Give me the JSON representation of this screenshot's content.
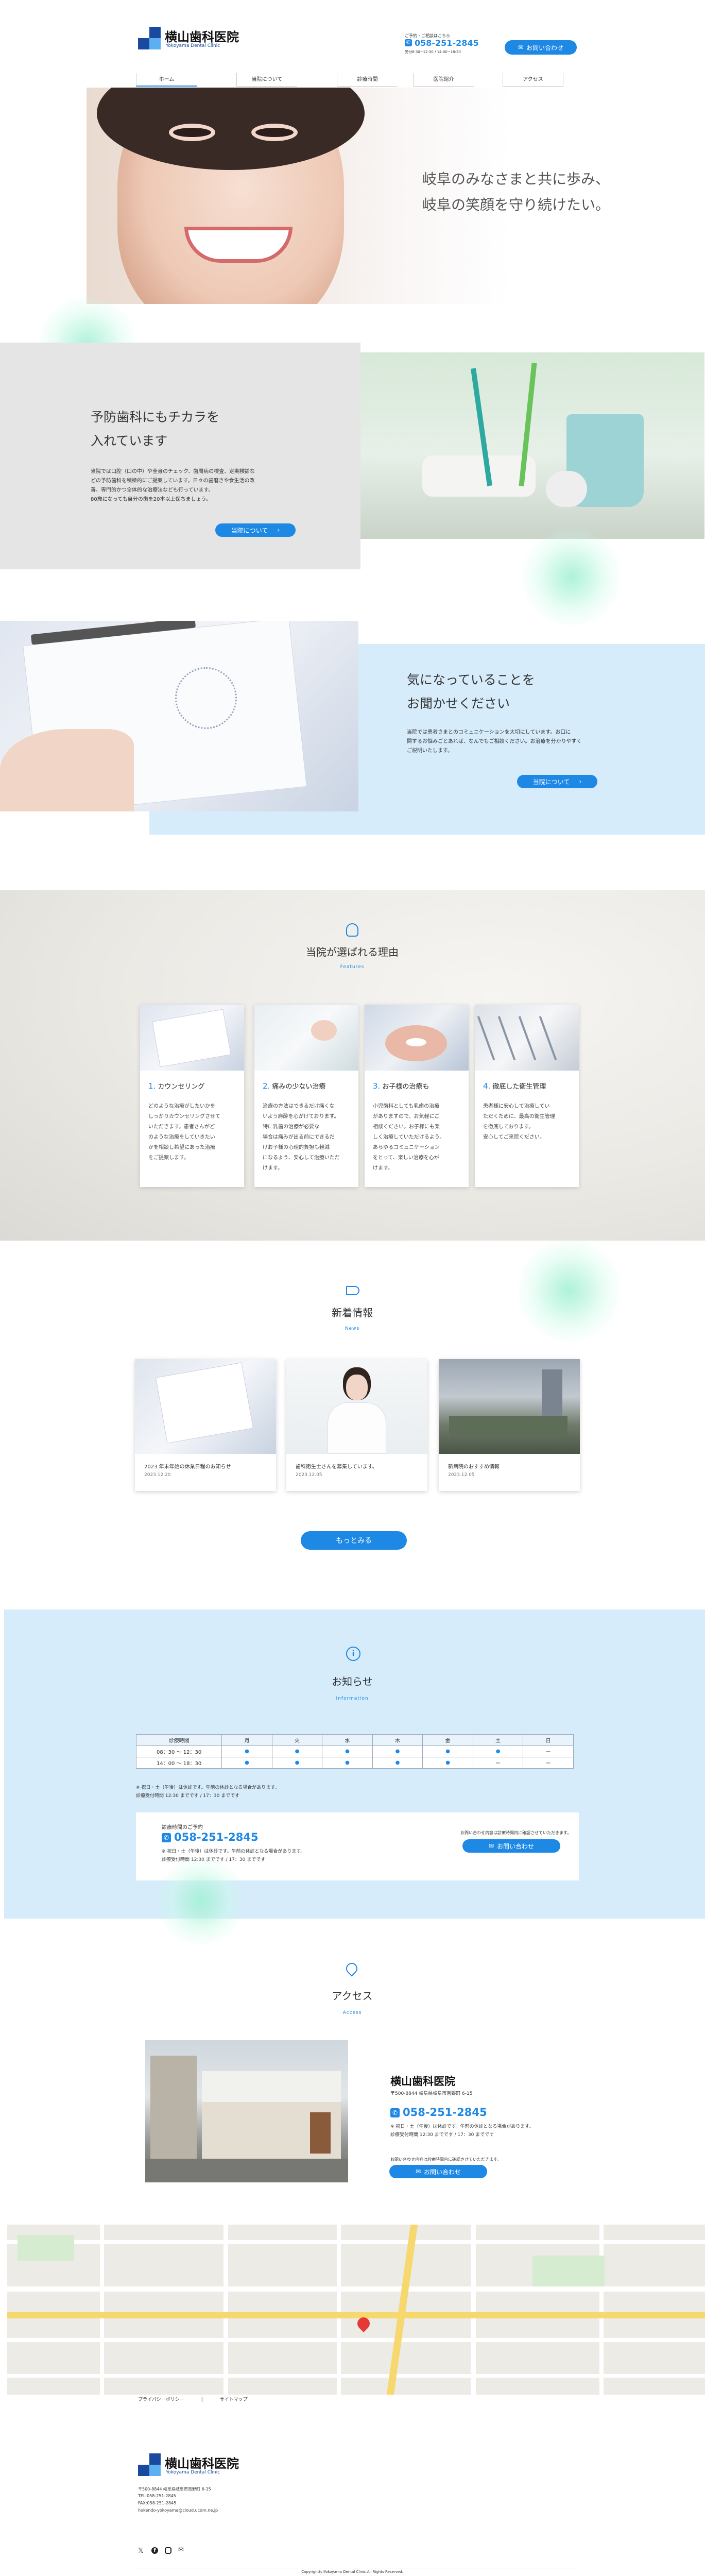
{
  "header": {
    "logo_name": "横山歯科医院",
    "logo_sub": "Yokoyama Dental Clinic",
    "reservation_note": "ご予約・ご相談はこちら",
    "phone": "058-251-2845",
    "hours_note": "受付8:30~12:30 / 14:00~18:30",
    "contact_button": "お問い合わせ",
    "nav": [
      "ホーム",
      "当院について",
      "診療時間",
      "医院紹介",
      "アクセス"
    ]
  },
  "hero": {
    "line1": "岐阜のみなさまと共に歩み、",
    "line2": "岐阜の笑顔を守り続けたい。"
  },
  "prevention": {
    "title_line1": "予防歯科にもチカラを",
    "title_line2": "入れています",
    "body": [
      "当院では口腔（口の中）や全身のチェック、歯周病の検査、定期検診な",
      "どの予防歯科を積極的にご提案しています。日々の歯磨きや食生活の改",
      "善、専門的かつ全体的な治療法なども行っています。",
      "80歳になっても自分の歯を20本以上保ちましょう。"
    ],
    "button": "当院について"
  },
  "consult": {
    "title_line1": "気になっていることを",
    "title_line2": "お聞かせください",
    "body": [
      "当院では患者さまとのコミュニケーションを大切にしています。お口に",
      "関するお悩みごとあれば、なんでもご相談ください。お治療を分かりやすく",
      "ご説明いたします。"
    ],
    "button": "当院について"
  },
  "reasons": {
    "title": "当院が選ばれる理由",
    "subtitle": "Features",
    "cards": [
      {
        "num": "1.",
        "title": "カウンセリング",
        "text": [
          "どのような治療がしたいかを",
          "しっかりカウンセリングさせて",
          "いただきます。患者さんがど",
          "のような治療をしていきたい",
          "かを相談し希望にあった治療",
          "をご提案します。"
        ]
      },
      {
        "num": "2.",
        "title": "痛みの少ない治療",
        "text": [
          "治療の方法はできるだけ痛くな",
          "いよう麻酔を心がけております。",
          "特に乳歯の治療が必要な",
          "場合は痛みが出る前にできるだ",
          "けお子様の心理的負担も軽減",
          "になるよう、安心して治療いただ",
          "けます。"
        ]
      },
      {
        "num": "3.",
        "title": "お子様の治療も",
        "text": [
          "小児歯科としても乳歯の治療",
          "がありますので、お気軽にご",
          "相談ください。お子様にも楽",
          "しく治療していただけるよう、",
          "あらゆるコミュニケーション",
          "をとって、楽しい治療を心が",
          "けます。"
        ]
      },
      {
        "num": "4.",
        "title": "徹底した衛生管理",
        "text": [
          "患者様に安心して治療してい",
          "ただくために、最高の衛生管理",
          "を徹底しております。",
          "安心してご来院ください。"
        ]
      }
    ]
  },
  "news": {
    "title": "新着情報",
    "subtitle": "News",
    "items": [
      {
        "title": "2023 年末年始の休業日程のお知らせ",
        "date": "2023.12.20"
      },
      {
        "title": "歯科衛生士さんを募集しています。",
        "date": "2023.12.05"
      },
      {
        "title": "新病院のおすすめ情報",
        "date": "2023.12.05"
      }
    ],
    "more_button": "もっとみる"
  },
  "info": {
    "title": "お知らせ",
    "subtitle": "Information",
    "table_header": [
      "診療時間",
      "月",
      "火",
      "水",
      "木",
      "金",
      "土",
      "日"
    ],
    "rows": [
      {
        "label": "08：30 ～ 12：30",
        "marks": [
          "●",
          "●",
          "●",
          "●",
          "●",
          "●",
          "ー"
        ]
      },
      {
        "label": "14：00 ～ 18：30",
        "marks": [
          "●",
          "●",
          "●",
          "●",
          "●",
          "ー",
          "ー"
        ]
      }
    ],
    "note1": "※ 祝日・土（午後）は休診です。午前の休診となる場合があります。",
    "note2": "診療受付時間 12:30 までです / 17：30 までです",
    "box_label": "診療時間のご予約",
    "box_phone": "058-251-2845",
    "box_note1": "※ 祝日・土（午後）は休診です。午前の休診となる場合があります。",
    "box_note2": "診療受付時間 12:30 までです / 17：30 までです",
    "box_right_note": "お問い合わせ内容は診療時間内に確認させていただきます。",
    "box_button": "お問い合わせ"
  },
  "access": {
    "title": "アクセス",
    "subtitle": "Access",
    "name": "横山歯科医院",
    "address": "〒500-8844 岐阜県岐阜市吉野町 6-15",
    "phone": "058-251-2845",
    "note1": "※ 祝日・土（午後）は休診です。午前の休診となる場合があります。",
    "note2": "診療受付時間 12:30 までです / 17：30 までです",
    "form_note": "お問い合わせ内容は診療時間内に確認させていただきます。",
    "button": "お問い合わせ"
  },
  "footer": {
    "links": [
      "プライバシーポリシー",
      "|",
      "サイトマップ"
    ],
    "logo_name": "横山歯科医院",
    "logo_sub": "Yokoyama Dental Clinic",
    "address": "〒500-8844 岐阜県岐阜市吉野町 6-15",
    "tel": "TEL:058-251-2845",
    "fax": "FAX:058-251-2845",
    "email": "hokendo-yokoyama@cloud.ucom.ne.jp",
    "copyright": "Copyright(c)Yokoyama Dental Clinic All Rights Reserved.",
    "social": [
      "x-icon",
      "facebook-icon",
      "instagram-icon",
      "mail-icon"
    ]
  },
  "colors": {
    "accent": "#1e88e5",
    "light_blue": "#d6ecfb",
    "mint": "#a6f0d2",
    "gray": "#e3e3e3"
  }
}
